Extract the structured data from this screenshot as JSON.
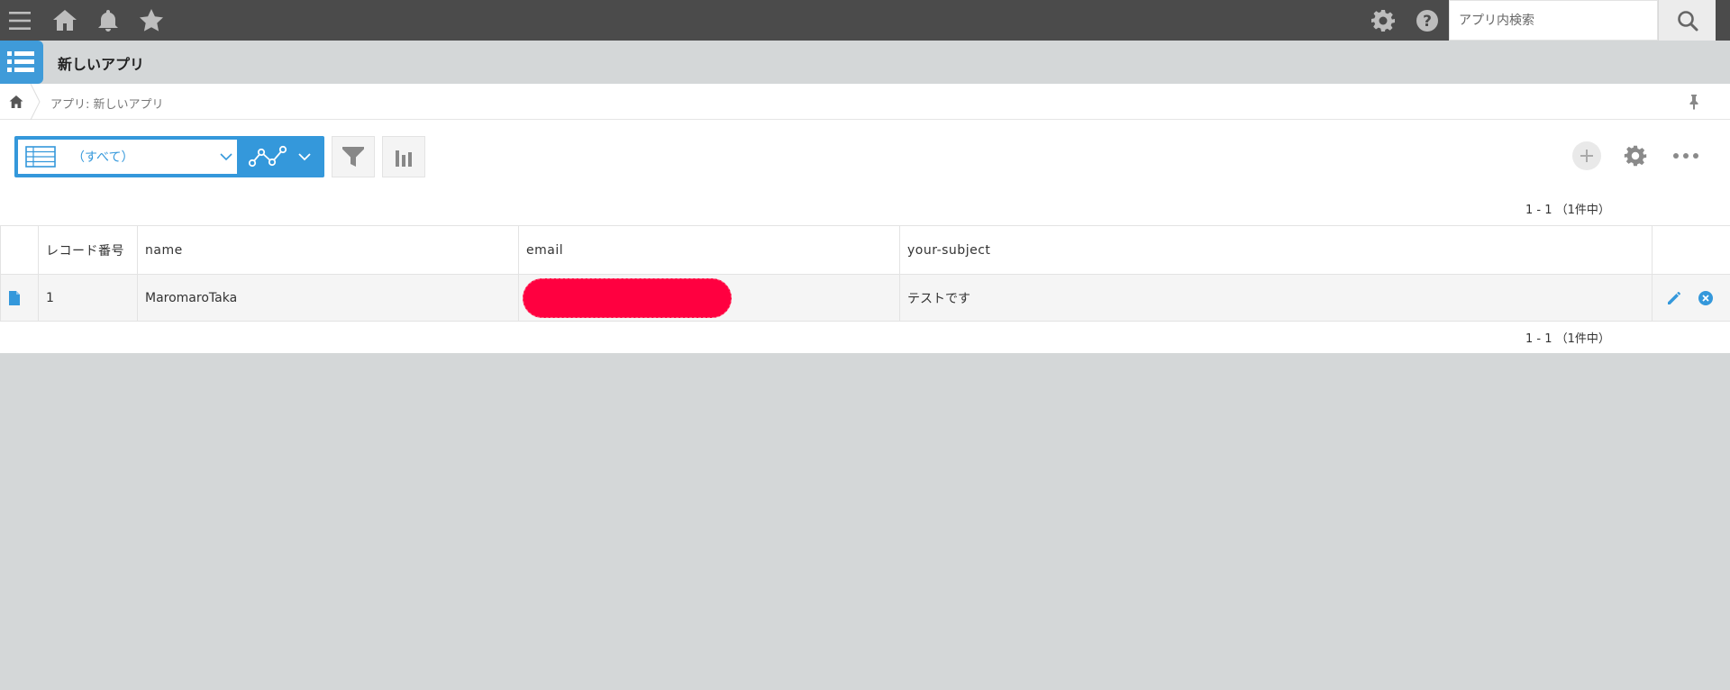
{
  "topbar": {
    "icons": [
      "menu-icon",
      "home-icon",
      "bell-icon",
      "star-icon",
      "gear-icon",
      "help-icon",
      "search-icon"
    ],
    "search_placeholder": "アプリ内検索"
  },
  "app": {
    "title": "新しいアプリ",
    "icon": "list-app-icon"
  },
  "breadcrumb": {
    "home_icon": "home-icon",
    "text": "アプリ: 新しいアプリ",
    "pin_icon": "pin-icon"
  },
  "toolbar": {
    "view_label": "（すべて）",
    "view_icon": "table-icon",
    "graph_icon": "graph-icon",
    "filter_icon": "filter-icon",
    "chart_icon": "bar-chart-icon",
    "add_icon": "plus-icon",
    "settings_icon": "gear-icon",
    "more_icon": "more-icon"
  },
  "pagination": {
    "top": "1 - 1 （1件中）",
    "bottom": "1 - 1 （1件中）"
  },
  "table": {
    "columns": [
      "",
      "レコード番号",
      "name",
      "email",
      "your-subject",
      ""
    ],
    "rows": [
      {
        "record_no": "1",
        "name": "MaromaroTaka",
        "email": "",
        "subject": "テストです"
      }
    ]
  },
  "colors": {
    "topbar": "#4b4b4b",
    "accent": "#3498db",
    "band": "#d4d7d8",
    "redaction": "#ff0040"
  }
}
